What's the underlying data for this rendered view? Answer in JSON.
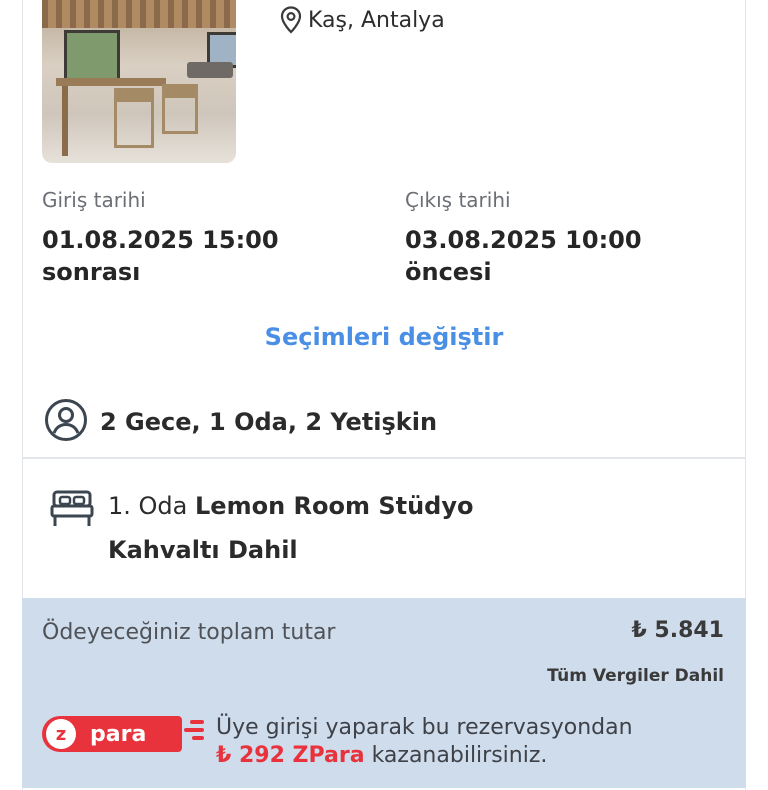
{
  "hotel": {
    "location": "Kaş, Antalya"
  },
  "dates": {
    "checkin_label": "Giriş tarihi",
    "checkin_value": "01.08.2025 15:00",
    "checkin_suffix": "sonrası",
    "checkout_label": "Çıkış tarihi",
    "checkout_value": "03.08.2025 10:00",
    "checkout_suffix": "öncesi"
  },
  "change_selection_link": "Seçimleri değiştir",
  "guests_summary": "2 Gece, 1 Oda, 2 Yetişkin",
  "room": {
    "index_label": "1. Oda",
    "name": "Lemon Room Stüdyo",
    "board": "Kahvaltı Dahil"
  },
  "total": {
    "label": "Ödeyeceğiniz toplam tutar",
    "value": "₺ 5.841",
    "tax_note": "Tüm Vergiler Dahil"
  },
  "zpara": {
    "badge_letter": "z",
    "badge_text": "para",
    "promo_line1": "Üye girişi yaparak bu rezervasyondan",
    "promo_amount": "₺ 292 ZPara",
    "promo_line2_rest": " kazanabilirsiniz."
  },
  "colors": {
    "link": "#4a8fe6",
    "panel": "#cfdcec",
    "zpara_red": "#e8333c"
  }
}
